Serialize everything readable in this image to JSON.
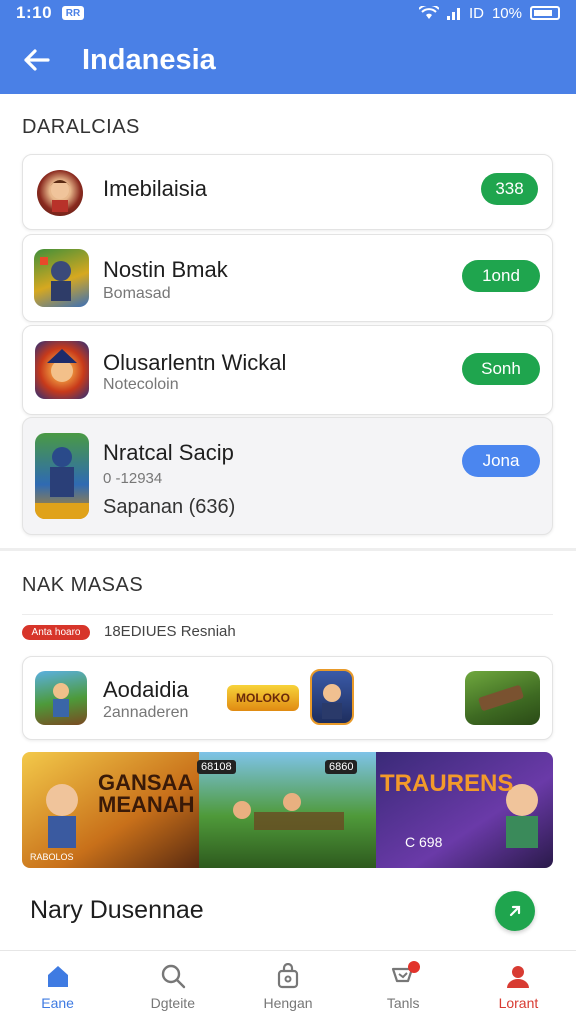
{
  "status_bar": {
    "time": "1:10",
    "notification": "RR",
    "signal": "ID",
    "battery": "10%"
  },
  "app_bar": {
    "title": "Indanesia"
  },
  "section1": {
    "label": "DARALCIAS",
    "items": [
      {
        "name": "Imebilaisia",
        "sub": "",
        "button": "338"
      },
      {
        "name": "Nostin Bmak",
        "sub": "Bomasad",
        "button": "1ond"
      },
      {
        "name": "Olusarlentn Wickal",
        "sub": "Notecoloin",
        "button": "Sonh"
      },
      {
        "name": "Nratcal Sacip",
        "sub": "0 -12934",
        "sub2": "Sapanan (636)",
        "button": "Jona"
      }
    ]
  },
  "section2": {
    "label": "NAK MASAS",
    "badge": "Anta hoaro",
    "meta": "18EDIUES Resniah",
    "item": {
      "name": "Aodaidia",
      "sub": "2annaderen",
      "logo_text": "MOLOKO"
    },
    "banner": {
      "left_title": "GANSAA MEANAH",
      "left_tag": "RABOLOS",
      "mid_tag1": "68108",
      "mid_tag2": "6860",
      "right_title": "TRAURENS",
      "right_tag": "C 698"
    }
  },
  "footer_row": {
    "title": "Nary Dusennae"
  },
  "bottom_nav": [
    {
      "label": "Eane",
      "icon": "home-icon"
    },
    {
      "label": "Dgteite",
      "icon": "search-icon"
    },
    {
      "label": "Hengan",
      "icon": "bag-icon"
    },
    {
      "label": "Tanls",
      "icon": "cart-icon"
    },
    {
      "label": "Lorant",
      "icon": "profile-icon"
    }
  ],
  "colors": {
    "primary": "#4a80e6",
    "green": "#1fa54e",
    "blue": "#4b86ef",
    "red": "#d83b32"
  }
}
